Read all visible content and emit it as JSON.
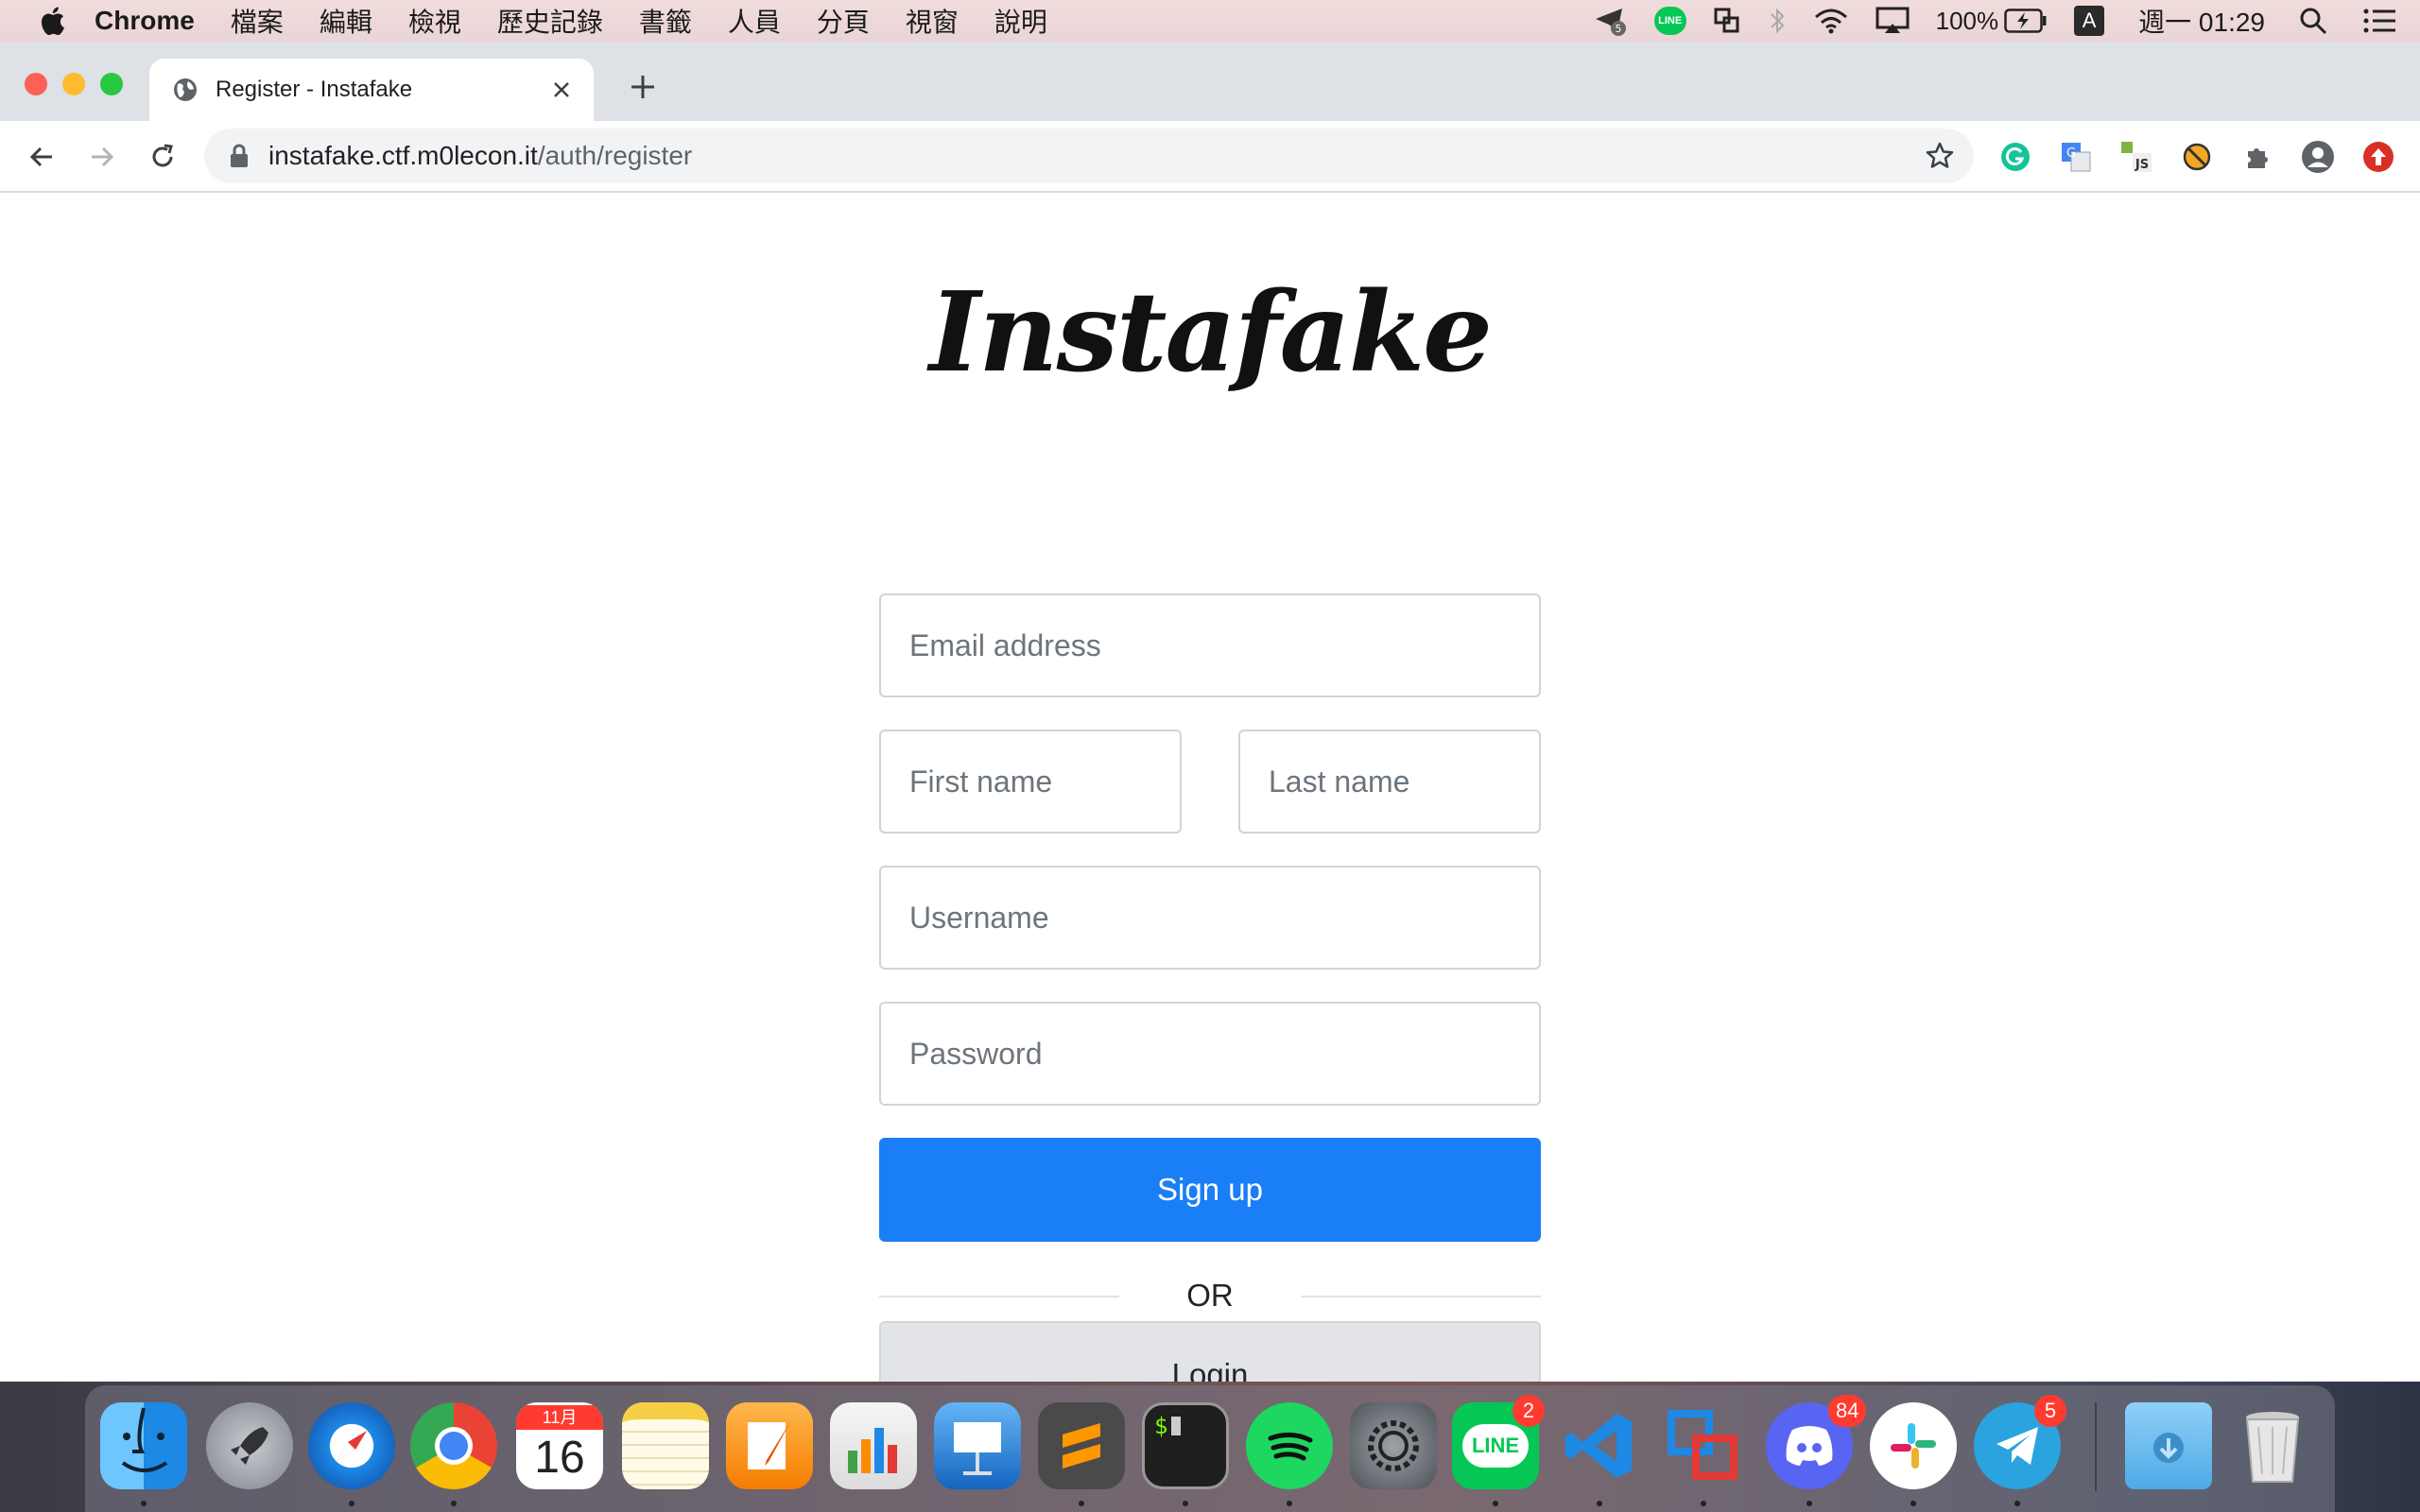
{
  "menubar": {
    "app_name": "Chrome",
    "menus": [
      "檔案",
      "編輯",
      "檢視",
      "歷史記錄",
      "書籤",
      "人員",
      "分頁",
      "視窗",
      "說明"
    ],
    "status": {
      "notification_count": "5",
      "line_label": "LINE",
      "battery": "100%",
      "input_method": "A",
      "datetime": "週一 01:29"
    }
  },
  "browser": {
    "tab_title": "Register - Instafake",
    "url_host": "instafake.ctf.m0lecon.it",
    "url_path": "/auth/register"
  },
  "page": {
    "logo": "Instafake",
    "email_placeholder": "Email address",
    "first_name_placeholder": "First name",
    "last_name_placeholder": "Last name",
    "username_placeholder": "Username",
    "password_placeholder": "Password",
    "signup_label": "Sign up",
    "or_label": "OR",
    "login_label": "Login"
  },
  "dock": {
    "calendar_month": "11月",
    "calendar_day": "16",
    "line_label": "LINE",
    "line_badge": "2",
    "discord_badge": "84",
    "telegram_badge": "5"
  },
  "colors": {
    "primary": "#1a7ef6",
    "menubar_bg": "#f1dcdc",
    "tabstrip_bg": "#dee1e6"
  }
}
